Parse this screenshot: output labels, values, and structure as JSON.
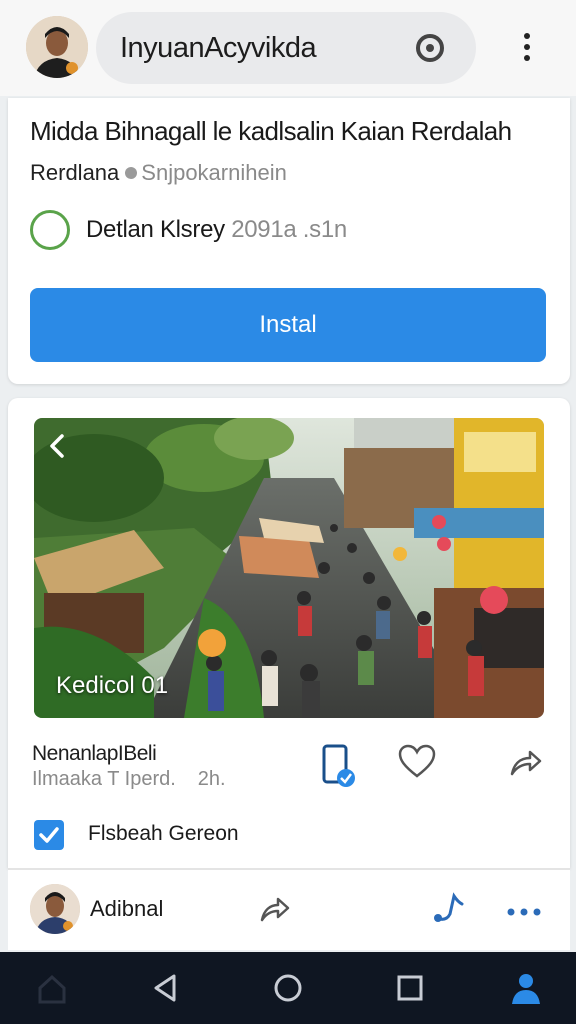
{
  "header": {
    "search_text": "InyuanAcyvikda",
    "search_icon": "target-icon",
    "menu_icon": "kebab-icon"
  },
  "app_card": {
    "title": "Midda Bihnagall le kadlsalin Kaian Rerdalah",
    "subtitle_main": "Rerdlana",
    "subtitle_handle": "Snjpokarnihein",
    "option_label": "Detlan Klsrey",
    "option_label_muted": "2091a .s1n",
    "install_label": "Instal",
    "accent": "#2b8ae6"
  },
  "post": {
    "image_caption": "Kedicol 01",
    "name": "NenanlapIBeli",
    "meta_left": "Ilmaaka T Iperd.",
    "meta_time": "2h.",
    "share_option": "Flsbeah Gereon"
  },
  "comment_row": {
    "name": "Adibnal"
  },
  "navbar": {
    "items": [
      "home-icon",
      "back-icon",
      "home-circle-icon",
      "recents-icon",
      "profile-icon"
    ]
  }
}
